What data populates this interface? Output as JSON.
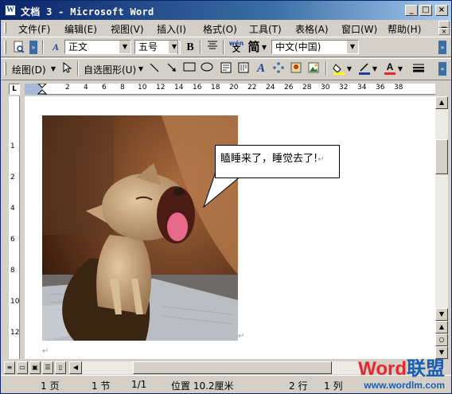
{
  "window": {
    "title": "文档 3 - Microsoft Word",
    "app_icon": "W"
  },
  "title_buttons": {
    "minimize": "_",
    "maximize": "□",
    "close": "×"
  },
  "menu": [
    "文件(F)",
    "编辑(E)",
    "视图(V)",
    "插入(I)",
    "格式(O)",
    "工具(T)",
    "表格(A)",
    "窗口(W)",
    "帮助(H)"
  ],
  "formatting_toolbar": {
    "style": "正文",
    "size": "五号",
    "bold": "B",
    "phonetic": "wén",
    "simplified": "简",
    "language": "中文(中国)"
  },
  "drawing_toolbar": {
    "draw_label": "绘图(D)",
    "autoshapes_label": "自选图形(U)"
  },
  "ruler": {
    "h_ticks": [
      "2",
      "2",
      "4",
      "6",
      "8",
      "10",
      "12",
      "14",
      "16",
      "18",
      "20",
      "22",
      "24",
      "26",
      "28",
      "30",
      "32",
      "34",
      "36",
      "38"
    ],
    "v_ticks": [
      "2",
      "1",
      "2",
      "4",
      "6",
      "8",
      "10",
      "12",
      "14"
    ]
  },
  "document": {
    "callout_text": "瞌睡来了，睡觉去了!",
    "paragraph_mark": "↵"
  },
  "status": {
    "page": "1 页",
    "section": "1 节",
    "page_of": "1/1",
    "position": "位置 10.2厘米",
    "line": "2 行",
    "column": "1 列"
  },
  "watermark": {
    "brand_a": "Word",
    "brand_b": "联盟",
    "url": "www.wordlm.com"
  },
  "colors": {
    "title_start": "#0a246a",
    "title_end": "#a6caf0",
    "chrome": "#d4d0c8",
    "brand_red": "#e8262c",
    "brand_blue": "#1a5fb4"
  }
}
